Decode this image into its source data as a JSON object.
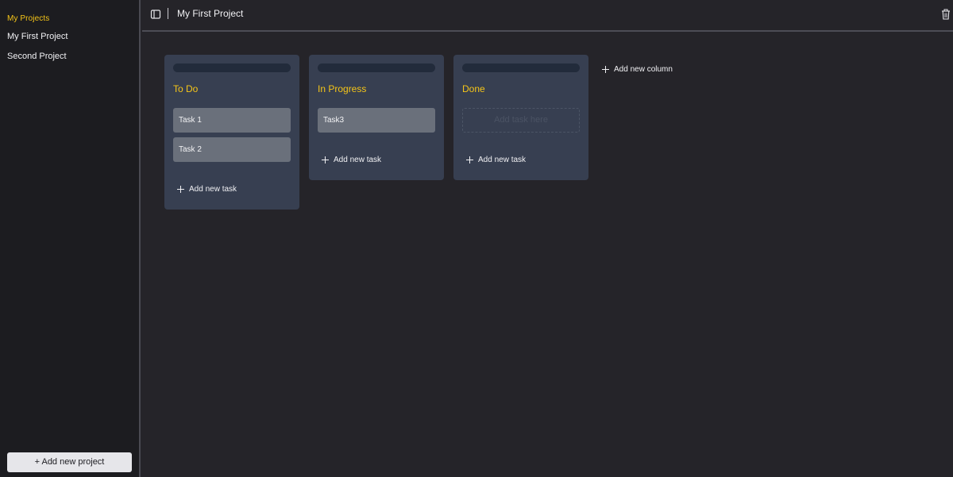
{
  "sidebar": {
    "title": "My Projects",
    "projects": [
      {
        "label": "My First Project"
      },
      {
        "label": "Second Project"
      }
    ],
    "add_project_label": "+ Add new project"
  },
  "header": {
    "title": "My First Project",
    "toggle_icon": "sidebar-toggle-icon",
    "trash_icon": "trash-icon"
  },
  "board": {
    "columns": [
      {
        "title": "To Do",
        "tasks": [
          "Task 1",
          "Task 2"
        ],
        "add_task_label": "Add new task"
      },
      {
        "title": "In Progress",
        "tasks": [
          "Task3"
        ],
        "add_task_label": "Add new task"
      },
      {
        "title": "Done",
        "tasks": [],
        "placeholder": "Add task here",
        "add_task_label": "Add new task"
      }
    ],
    "add_column_label": "Add new column"
  },
  "colors": {
    "accent": "#f5c518",
    "background": "#252429",
    "sidebar": "#1c1c20",
    "column": "#373f51",
    "task": "#6a707b"
  }
}
